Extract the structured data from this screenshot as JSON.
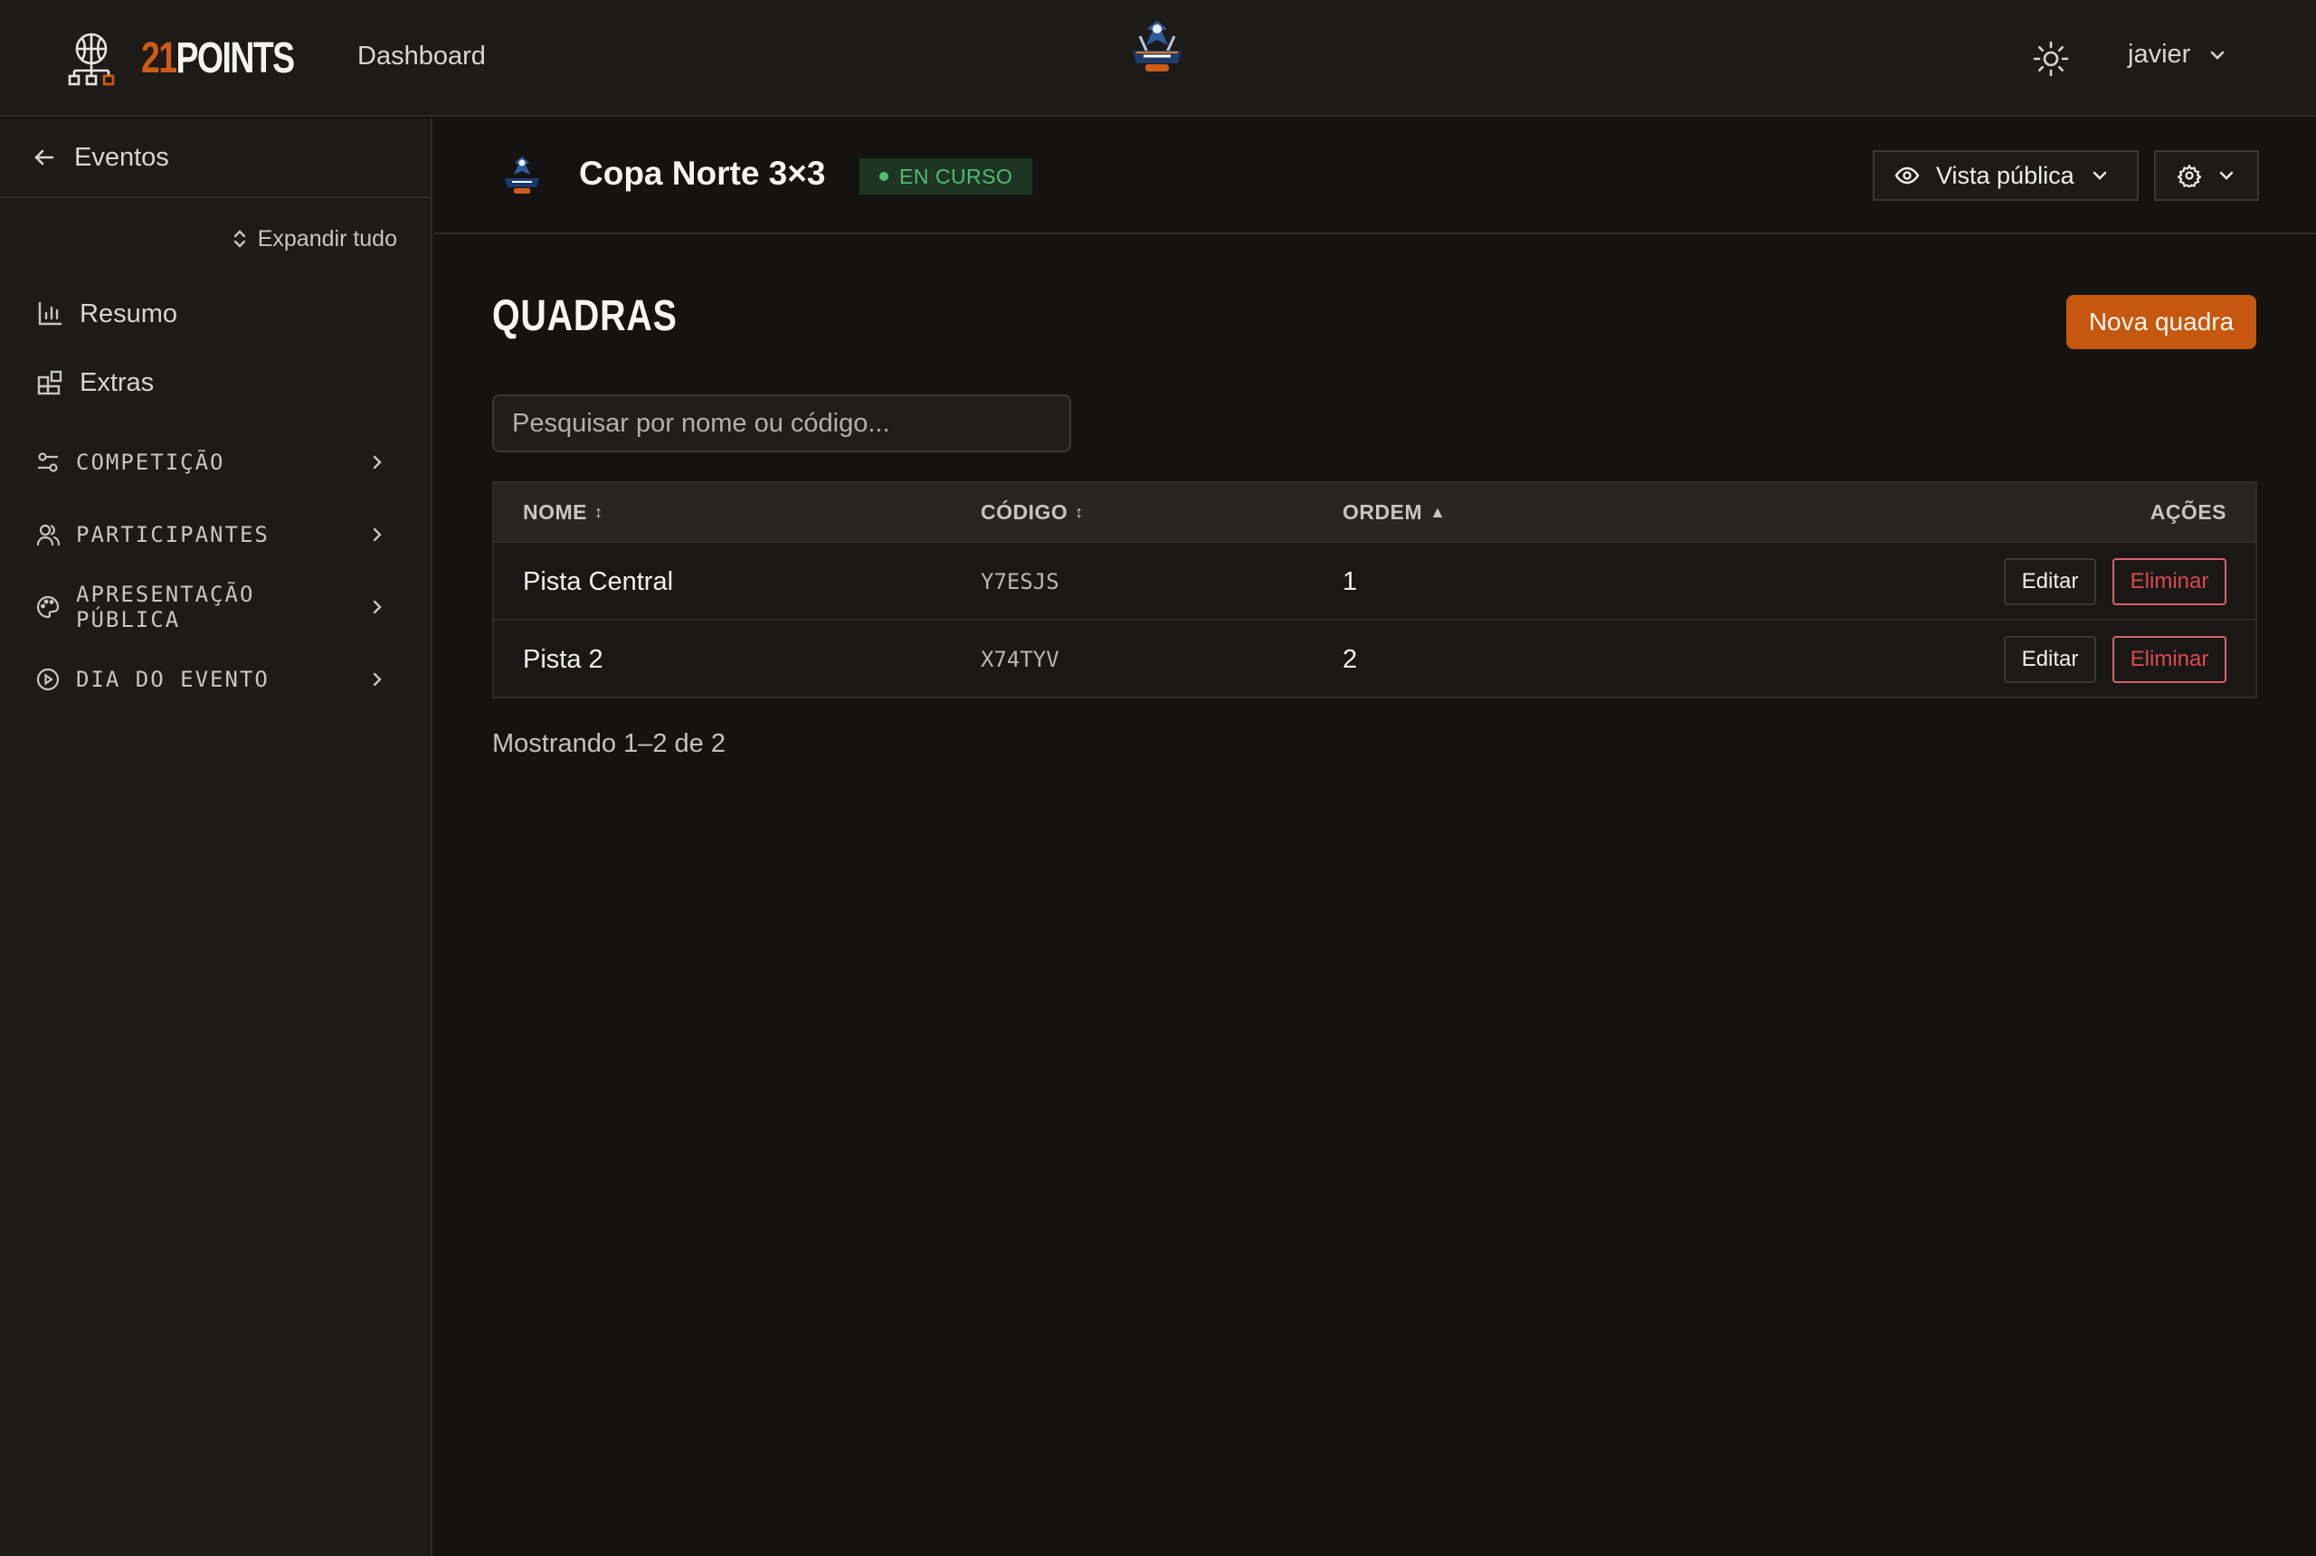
{
  "header": {
    "brand_number": "21",
    "brand_word": "POINTS",
    "nav_dashboard": "Dashboard",
    "user_name": "javier"
  },
  "sidebar": {
    "back_label": "Eventos",
    "expand_label": "Expandir tudo",
    "items": [
      {
        "label": "Resumo",
        "icon": "bar-chart-icon"
      },
      {
        "label": "Extras",
        "icon": "blocks-icon"
      }
    ],
    "groups": [
      {
        "label": "COMPETIÇÃO",
        "icon": "sliders-icon"
      },
      {
        "label": "PARTICIPANTES",
        "icon": "users-icon"
      },
      {
        "label": "APRESENTAÇÃO PÚBLICA",
        "icon": "palette-icon"
      },
      {
        "label": "DIA DO EVENTO",
        "icon": "play-circle-icon"
      }
    ]
  },
  "event": {
    "title": "Copa Norte 3×3",
    "status": "EN CURSO",
    "public_view_label": "Vista pública"
  },
  "main": {
    "title": "QUADRAS",
    "new_button": "Nova quadra",
    "search_placeholder": "Pesquisar por nome ou código...",
    "table": {
      "headers": {
        "name": "NOME",
        "code": "CÓDIGO",
        "order": "ORDEM",
        "actions": "AÇÕES"
      },
      "sort_both": "↕",
      "sort_asc": "▲",
      "rows": [
        {
          "name": "Pista Central",
          "code": "Y7ESJS",
          "order": "1"
        },
        {
          "name": "Pista 2",
          "code": "X74TYV",
          "order": "2"
        }
      ],
      "edit_label": "Editar",
      "delete_label": "Eliminar"
    },
    "pagination_info": "Mostrando 1–2 de 2"
  },
  "colors": {
    "accent": "#c5570f",
    "status_green": "#4fbd6e",
    "danger": "#e0484f"
  }
}
